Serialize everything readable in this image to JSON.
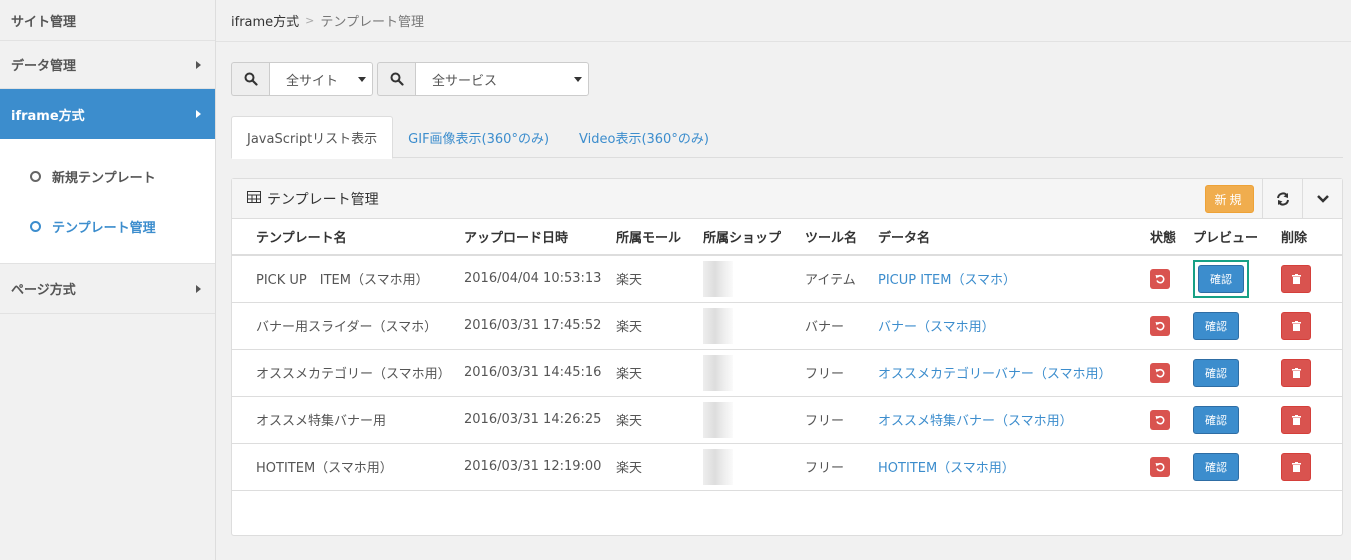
{
  "sidebar": {
    "items": [
      {
        "label": "サイト管理"
      },
      {
        "label": "データ管理"
      },
      {
        "label": "iframe方式"
      },
      {
        "label": "ページ方式"
      }
    ],
    "submenu": [
      {
        "label": "新規テンプレート"
      },
      {
        "label": "テンプレート管理"
      }
    ]
  },
  "breadcrumb": {
    "first": "iframe方式",
    "current": "テンプレート管理"
  },
  "filters": {
    "site": "全サイト",
    "service": "全サービス"
  },
  "tabs": [
    {
      "label": "JavaScriptリスト表示"
    },
    {
      "label": "GIF画像表示(360°のみ)"
    },
    {
      "label": "Video表示(360°のみ)"
    }
  ],
  "panel": {
    "title": "テンプレート管理",
    "new_label": "新規"
  },
  "table": {
    "headers": [
      "テンプレート名",
      "アップロード日時",
      "所属モール",
      "所属ショップ",
      "ツール名",
      "データ名",
      "状態",
      "プレビュー",
      "削除"
    ],
    "confirm_label": "確認",
    "rows": [
      {
        "name": "PICK UP　ITEM（スマホ用）",
        "date": "2016/04/04 10:53:13",
        "mall": "楽天",
        "tool": "アイテム",
        "data": "PICUP ITEM（スマホ）"
      },
      {
        "name": "バナー用スライダー（スマホ）",
        "date": "2016/03/31 17:45:52",
        "mall": "楽天",
        "tool": "バナー",
        "data": "バナー（スマホ用）"
      },
      {
        "name": "オススメカテゴリー（スマホ用）",
        "date": "2016/03/31 14:45:16",
        "mall": "楽天",
        "tool": "フリー",
        "data": "オススメカテゴリーバナー（スマホ用）"
      },
      {
        "name": "オススメ特集バナー用",
        "date": "2016/03/31 14:26:25",
        "mall": "楽天",
        "tool": "フリー",
        "data": "オススメ特集バナー（スマホ用）"
      },
      {
        "name": "HOTITEM（スマホ用）",
        "date": "2016/03/31 12:19:00",
        "mall": "楽天",
        "tool": "フリー",
        "data": "HOTITEM（スマホ用）"
      }
    ]
  },
  "colors": {
    "primary": "#3c8dcd",
    "warning": "#f0ad4e",
    "danger": "#d9534f",
    "highlight": "#17a085"
  }
}
